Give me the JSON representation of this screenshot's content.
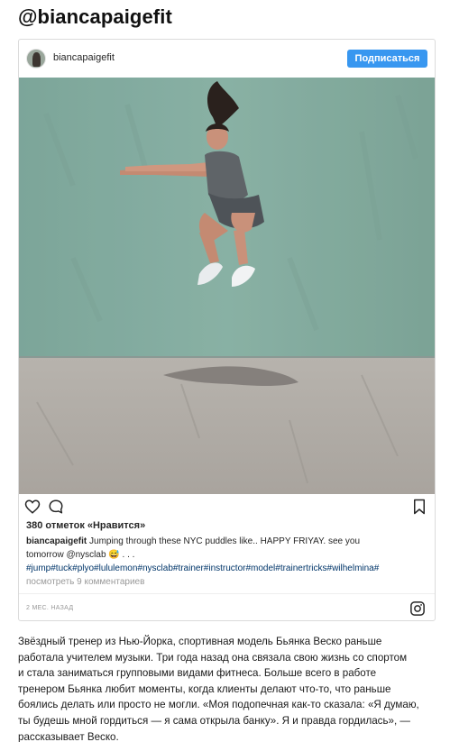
{
  "page": {
    "heading": "@biancapaigefit"
  },
  "post": {
    "username": "biancapaigefit",
    "follow_label": "Подписаться",
    "likes": "380 отметок «Нравится»",
    "caption": {
      "user": "biancapaigefit",
      "text": "Jumping through these NYC puddles like.. HAPPY FRIYAY. see you",
      "line2": "tomorrow @nysclab 😅 . . .",
      "hashtags": "#jump#tuck#plyo#lululemon#nysclab#trainer#instructor#model#trainertricks#wilhelmina#"
    },
    "comments_link": "посмотреть 9 комментариев",
    "timestamp": "2 МЕС. НАЗАД",
    "icons": {
      "like": "heart-icon",
      "comment": "comment-icon",
      "save": "bookmark-icon",
      "brand": "instagram-icon"
    },
    "colors": {
      "follow_button": "#3897f0",
      "hashtag": "#003569",
      "muted": "#999999"
    }
  },
  "article": {
    "lines": [
      "Звёздный тренер из Нью-Йорка, спортивная модель Бьянка Веско раньше",
      "работала учителем музыки. Три года назад она связала свою жизнь со спортом",
      "и стала заниматься групповыми видами фитнеса. Больше всего в работе",
      "тренером Бьянка любит моменты, когда клиенты делают что-то, что раньше",
      "боялись делать или просто не могли. «Моя подопечная как-то сказала: «Я думаю,",
      "ты будешь мной гордиться — я сама открыла банку». Я и правда гордилась», —",
      "рассказывает Веско."
    ]
  }
}
